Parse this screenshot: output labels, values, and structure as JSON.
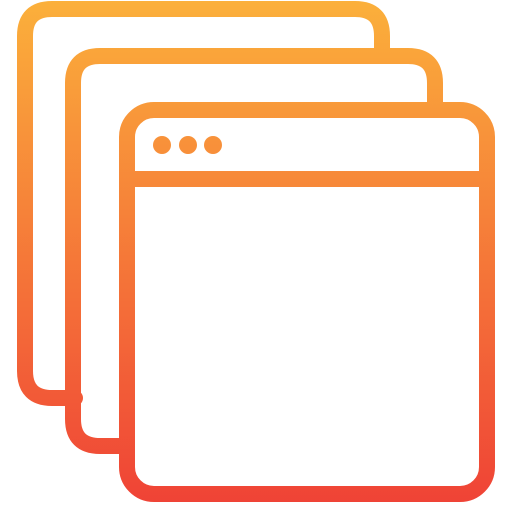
{
  "icon": {
    "name": "stacked-browser-windows-icon",
    "gradient": {
      "top_color": "#FBB03B",
      "bottom_color": "#EF4136"
    },
    "layers": 3,
    "window_control_dots": 3
  }
}
